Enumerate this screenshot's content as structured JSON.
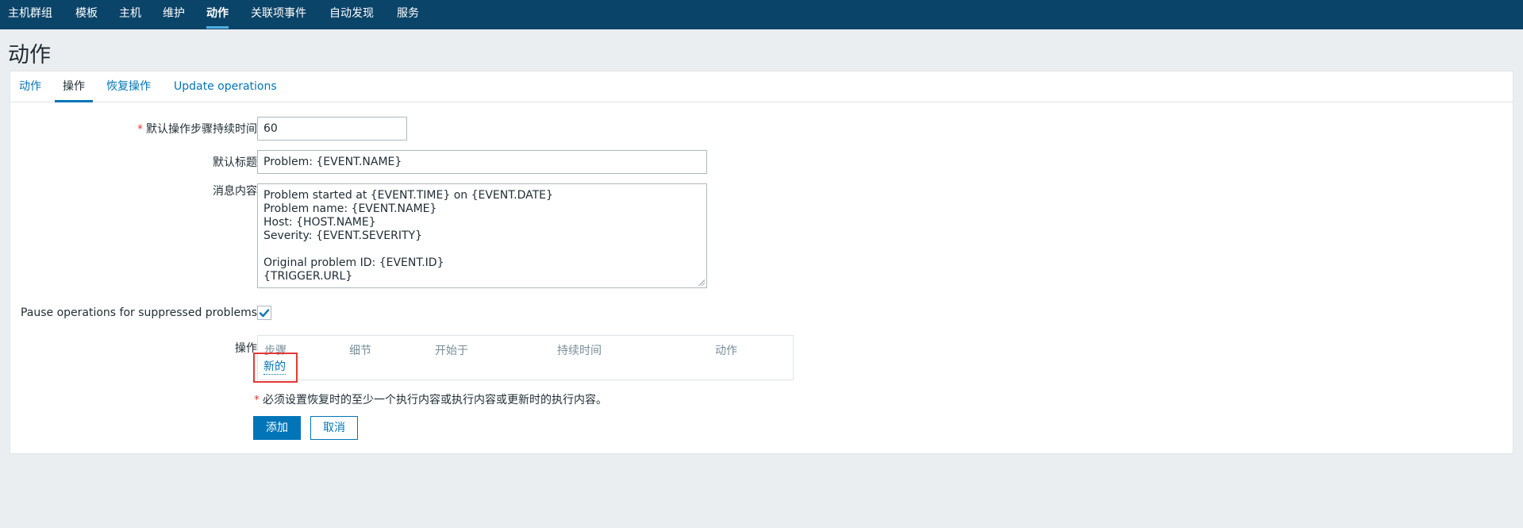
{
  "top_nav": {
    "items": [
      {
        "label": "主机群组",
        "active": false
      },
      {
        "label": "模板",
        "active": false
      },
      {
        "label": "主机",
        "active": false
      },
      {
        "label": "维护",
        "active": false
      },
      {
        "label": "动作",
        "active": true
      },
      {
        "label": "关联项事件",
        "active": false
      },
      {
        "label": "自动发现",
        "active": false
      },
      {
        "label": "服务",
        "active": false
      }
    ]
  },
  "page": {
    "title": "动作"
  },
  "tabs": [
    {
      "label": "动作",
      "active": false
    },
    {
      "label": "操作",
      "active": true
    },
    {
      "label": "恢复操作",
      "active": false
    },
    {
      "label": "Update operations",
      "active": false
    }
  ],
  "form": {
    "default_step_duration": {
      "label": "默认操作步骤持续时间",
      "required_mark": "*",
      "value": "60"
    },
    "default_subject": {
      "label": "默认标题",
      "value": "Problem: {EVENT.NAME}"
    },
    "default_message": {
      "label": "消息内容",
      "value": "Problem started at {EVENT.TIME} on {EVENT.DATE}\nProblem name: {EVENT.NAME}\nHost: {HOST.NAME}\nSeverity: {EVENT.SEVERITY}\n\nOriginal problem ID: {EVENT.ID}\n{TRIGGER.URL}"
    },
    "pause_suppressed": {
      "label": "Pause operations for suppressed problems",
      "checked": true
    },
    "operations": {
      "label": "操作",
      "columns": [
        "步骤",
        "细节",
        "开始于",
        "持续时间",
        "动作"
      ],
      "new_link": "新的"
    },
    "hint": {
      "required_mark": "*",
      "text": "必须设置恢复时的至少一个执行内容或执行内容或更新时的执行内容。"
    },
    "buttons": {
      "add": "添加",
      "cancel": "取消"
    }
  },
  "colors": {
    "nav_background": "#0b4469",
    "accent": "#0275b8",
    "highlight_box": "#e53935",
    "page_background": "#ebeef0"
  }
}
